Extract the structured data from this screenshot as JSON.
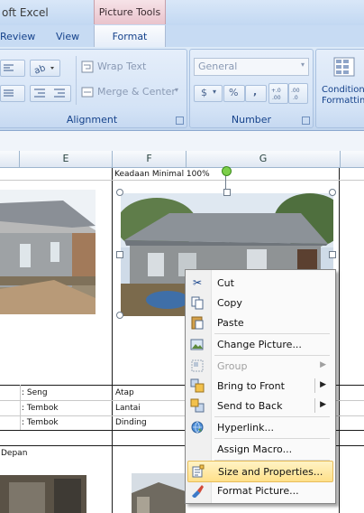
{
  "app_title": "oft Excel",
  "picture_tools": "Picture Tools",
  "tabs": {
    "review": "Review",
    "view": "View",
    "format": "Format"
  },
  "ribbon": {
    "alignment": {
      "label": "Alignment",
      "wrap_text": "Wrap Text",
      "merge_center": "Merge & Center"
    },
    "number": {
      "label": "Number",
      "format_value": "General",
      "currency": "$",
      "percent": "%",
      "comma": ",",
      "inc_decimal": "+.0 .00",
      "dec_decimal": ".00 →.0"
    },
    "styles": {
      "conditional_formatting": "Conditional Formatting"
    }
  },
  "columns": [
    "E",
    "F",
    "G"
  ],
  "cells": {
    "f_header": "Keadaan Minimal 100%",
    "row1_e": ": Seng",
    "row1_f": "Atap",
    "row2_e": ": Tembok",
    "row2_f": "Lantai",
    "row3_e": ": Tembok",
    "row3_f": "Dinding",
    "row4_a": "Depan"
  },
  "context_menu": {
    "items": [
      {
        "label": "Cut",
        "icon": "scissors-icon",
        "disabled": false,
        "submenu": false
      },
      {
        "label": "Copy",
        "icon": "copy-icon",
        "disabled": false,
        "submenu": false
      },
      {
        "label": "Paste",
        "icon": "paste-icon",
        "disabled": false,
        "submenu": false
      },
      {
        "label": "Change Picture...",
        "icon": "change-picture-icon",
        "disabled": false,
        "submenu": false
      },
      {
        "label": "Group",
        "icon": "group-icon",
        "disabled": true,
        "submenu": true
      },
      {
        "label": "Bring to Front",
        "icon": "bring-to-front-icon",
        "disabled": false,
        "submenu": true
      },
      {
        "label": "Send to Back",
        "icon": "send-to-back-icon",
        "disabled": false,
        "submenu": true
      },
      {
        "label": "Hyperlink...",
        "icon": "hyperlink-icon",
        "disabled": false,
        "submenu": false
      },
      {
        "label": "Assign Macro...",
        "icon": "",
        "disabled": false,
        "submenu": false
      },
      {
        "label": "Size and Properties...",
        "icon": "size-properties-icon",
        "disabled": false,
        "submenu": false,
        "highlighted": true
      },
      {
        "label": "Format Picture...",
        "icon": "format-picture-icon",
        "disabled": false,
        "submenu": false
      }
    ]
  },
  "colors": {
    "ribbon": "#d1e1f5",
    "picture_tools_tab": "#e9c3cc",
    "menu_highlight": "#ffe08a"
  }
}
